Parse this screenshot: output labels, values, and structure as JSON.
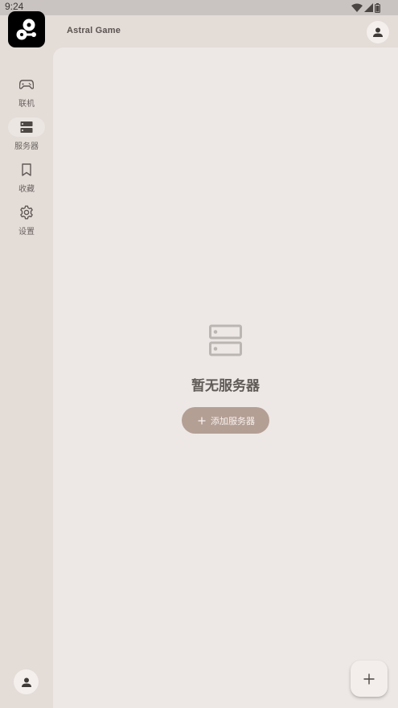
{
  "status_bar": {
    "time": "9:24",
    "icons": [
      "wifi-icon",
      "signal-icon",
      "battery-icon"
    ]
  },
  "header": {
    "app_name": "Astral Game",
    "account_icon": "account-icon"
  },
  "nav_rail": {
    "items": [
      {
        "label": "联机",
        "icon": "gamepad-icon",
        "active": false
      },
      {
        "label": "服务器",
        "icon": "server-icon",
        "active": true
      },
      {
        "label": "收藏",
        "icon": "bookmark-icon",
        "active": false
      },
      {
        "label": "设置",
        "icon": "gear-icon",
        "active": false
      }
    ],
    "account_icon": "account-icon"
  },
  "main": {
    "empty_state": {
      "icon": "server-icon",
      "title": "暂无服务器",
      "button_label": "添加服务器"
    },
    "fab_icon": "plus-icon"
  },
  "colors": {
    "background": "#e3dcd7",
    "panel": "#ede8e5",
    "accent_button": "#b49f95",
    "text": "#615b58"
  }
}
